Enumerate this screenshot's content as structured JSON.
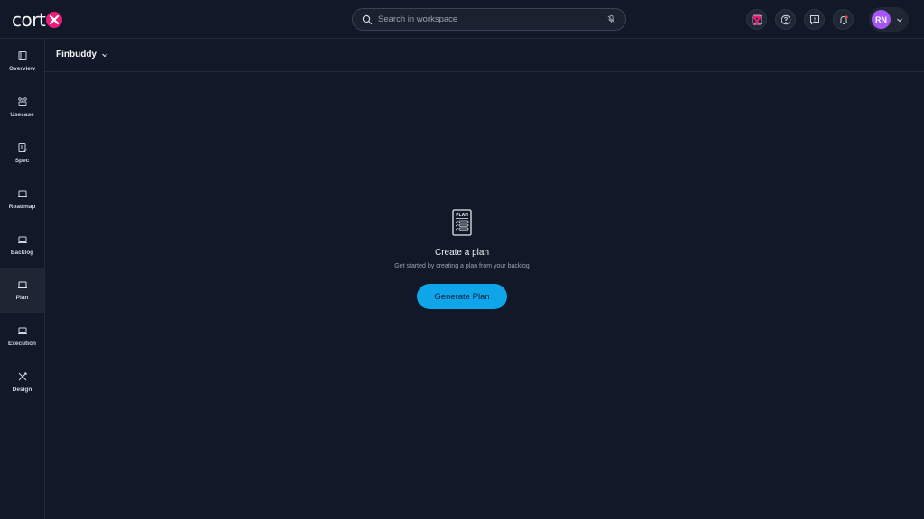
{
  "app": {
    "logo_text": "cort",
    "brand_color": "#ec1c7a",
    "accent_color": "#0ea5e9"
  },
  "search": {
    "placeholder": "Search in workspace",
    "value": ""
  },
  "toolbar": {
    "icons": [
      "cortex-assistant-icon",
      "help-icon",
      "feedback-icon",
      "notification-bell-icon"
    ]
  },
  "user": {
    "initials": "RN"
  },
  "sidebar": {
    "items": [
      {
        "label": "Overview",
        "icon": "overview-icon"
      },
      {
        "label": "Usecase",
        "icon": "usecase-icon"
      },
      {
        "label": "Spec",
        "icon": "spec-icon"
      },
      {
        "label": "Roadmap",
        "icon": "roadmap-icon"
      },
      {
        "label": "Backlog",
        "icon": "backlog-icon"
      },
      {
        "label": "Plan",
        "icon": "plan-icon",
        "active": true
      },
      {
        "label": "Execution",
        "icon": "execution-icon"
      },
      {
        "label": "Design",
        "icon": "design-icon"
      }
    ]
  },
  "header": {
    "project_name": "Finbuddy"
  },
  "empty_state": {
    "illustration_label": "PLAN",
    "title": "Create a plan",
    "subtitle": "Get started by creating a plan from your backlog",
    "button_label": "Generate Plan"
  }
}
